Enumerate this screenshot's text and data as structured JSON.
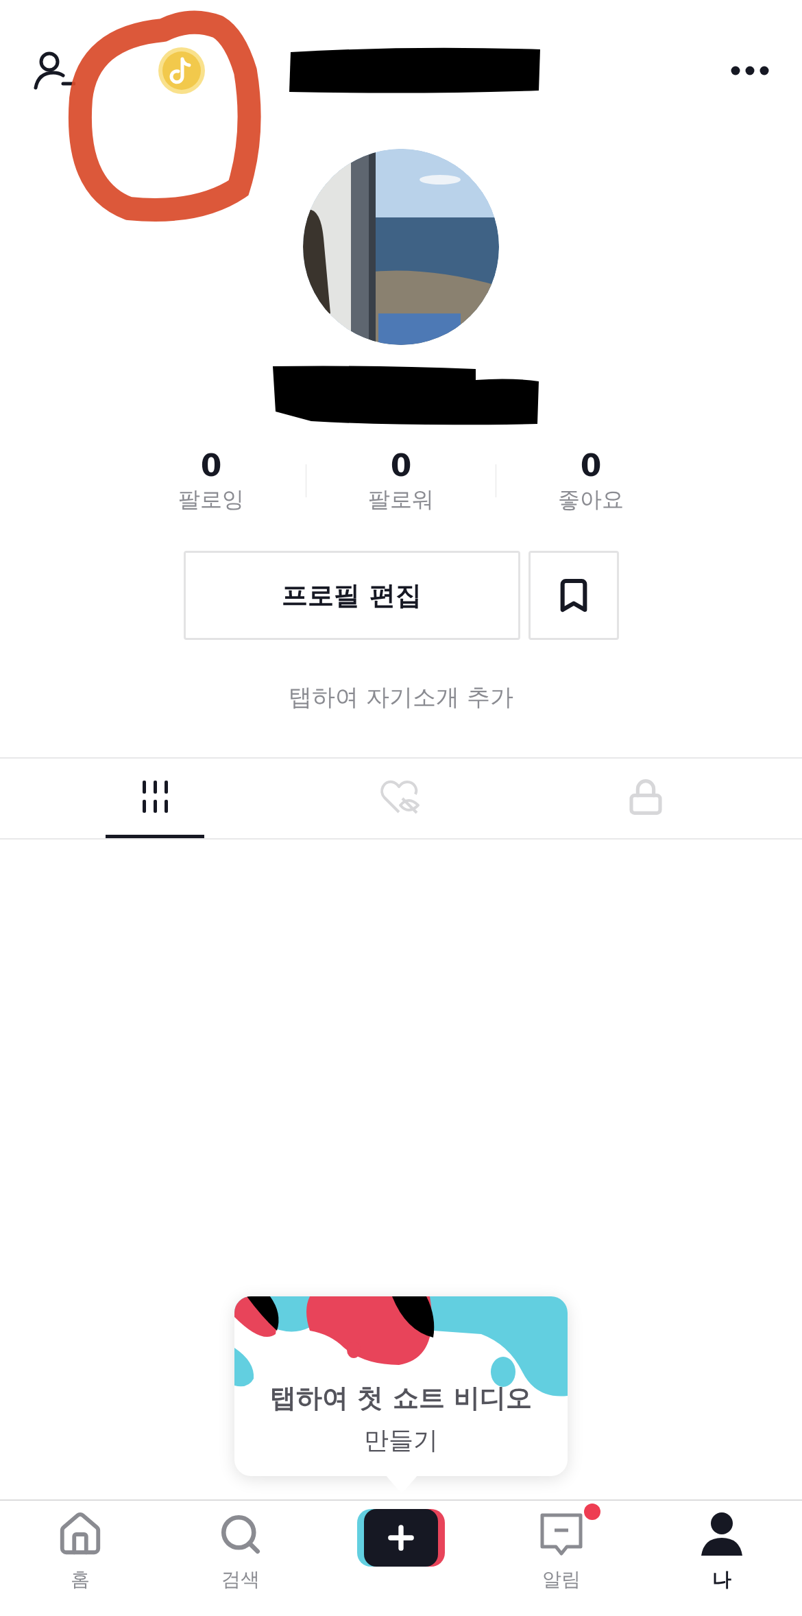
{
  "stats": [
    {
      "value": "0",
      "label": "팔로잉"
    },
    {
      "value": "0",
      "label": "팔로워"
    },
    {
      "value": "0",
      "label": "좋아요"
    }
  ],
  "edit_button": "프로필 편집",
  "bio_placeholder": "탭하여 자기소개 추가",
  "profile_tabs": [
    {
      "kind": "videos",
      "selected": true
    },
    {
      "kind": "liked",
      "selected": false
    },
    {
      "kind": "private",
      "selected": false
    }
  ],
  "tooltip": {
    "title": "탭하여 첫 쇼트 비디오",
    "subtitle": "만들기"
  },
  "nav": [
    {
      "kind": "home",
      "label": "홈",
      "selected": false,
      "badge": false
    },
    {
      "kind": "search",
      "label": "검색",
      "selected": false,
      "badge": false
    },
    {
      "kind": "create"
    },
    {
      "kind": "inbox",
      "label": "알림",
      "selected": false,
      "badge": true
    },
    {
      "kind": "me",
      "label": "나",
      "selected": true,
      "badge": false
    }
  ]
}
